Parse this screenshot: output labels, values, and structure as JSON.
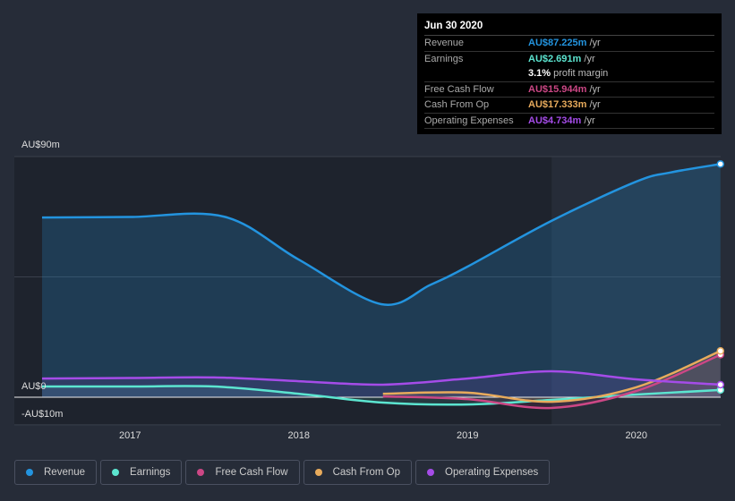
{
  "tooltip": {
    "date": "Jun 30 2020",
    "rows": [
      {
        "label": "Revenue",
        "value": "AU$87.225m",
        "unit": " /yr",
        "color": "#2394df"
      },
      {
        "label": "Earnings",
        "value": "AU$2.691m",
        "unit": " /yr",
        "color": "#5ce5d0"
      },
      {
        "label": "",
        "value": "3.1%",
        "unit": " profit margin",
        "color": "#ffffff"
      },
      {
        "label": "Free Cash Flow",
        "value": "AU$15.944m",
        "unit": " /yr",
        "color": "#cc4785"
      },
      {
        "label": "Cash From Op",
        "value": "AU$17.333m",
        "unit": " /yr",
        "color": "#e8ab5c"
      },
      {
        "label": "Operating Expenses",
        "value": "AU$4.734m",
        "unit": " /yr",
        "color": "#a54ce8"
      }
    ]
  },
  "chart_data": {
    "type": "line",
    "ylabels": {
      "top": "AU$90m",
      "zero": "AU$0",
      "bottom": "-AU$10m"
    },
    "ylim": [
      -10,
      90
    ],
    "xlim": [
      2016.48,
      2020.5
    ],
    "xticks": [
      "2017",
      "2018",
      "2019",
      "2020"
    ],
    "highlight_from": 2019.5,
    "series": [
      {
        "name": "Revenue",
        "color": "#2394df",
        "x": [
          2016.48,
          2017,
          2017.56,
          2018,
          2018.49,
          2018.78,
          2019,
          2019.5,
          2020,
          2020.2,
          2020.5
        ],
        "values": [
          67.2,
          67.4,
          67.5,
          51.5,
          34.8,
          42,
          48.8,
          66,
          80.6,
          84,
          87.2
        ]
      },
      {
        "name": "Earnings",
        "color": "#5ce5d0",
        "x": [
          2016.48,
          2017,
          2017.5,
          2018,
          2018.5,
          2019,
          2019.5,
          2020,
          2020.5
        ],
        "values": [
          4,
          4,
          4,
          1.3,
          -2,
          -2.7,
          -1,
          1,
          2.7
        ]
      },
      {
        "name": "Free Cash Flow",
        "color": "#cc4785",
        "x": [
          2018.5,
          2019,
          2019.5,
          2020,
          2020.5
        ],
        "values": [
          0.3,
          -0.7,
          -4,
          2.3,
          15.9
        ]
      },
      {
        "name": "Cash From Op",
        "color": "#e8ab5c",
        "x": [
          2018.5,
          2019,
          2019.5,
          2020,
          2020.5
        ],
        "values": [
          1.3,
          1.7,
          -1.7,
          3.7,
          17.3
        ]
      },
      {
        "name": "Operating Expenses",
        "color": "#a54ce8",
        "x": [
          2016.48,
          2017,
          2017.5,
          2018,
          2018.5,
          2019,
          2019.5,
          2020,
          2020.5
        ],
        "values": [
          7,
          7.2,
          7.4,
          6,
          4.7,
          7,
          9.7,
          6.7,
          4.7
        ]
      }
    ]
  }
}
